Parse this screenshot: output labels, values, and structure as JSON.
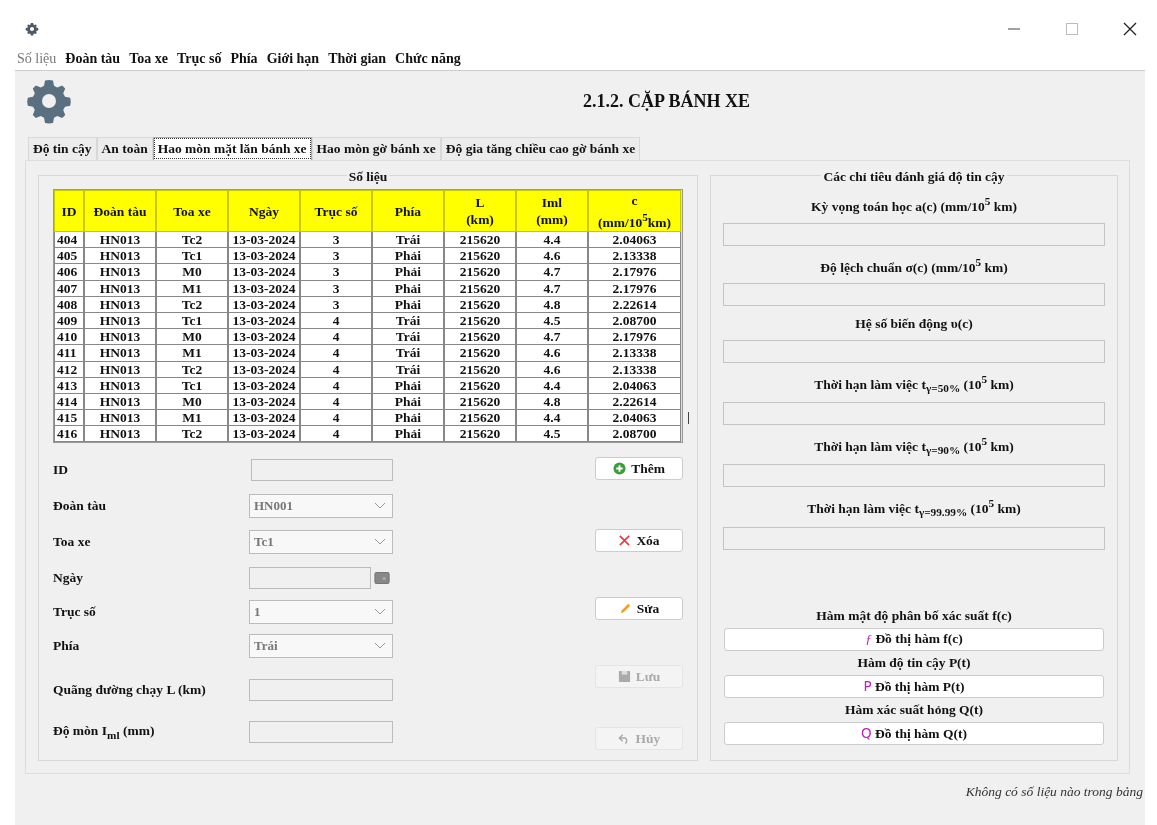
{
  "menu": [
    {
      "label": "Số liệu",
      "disabled": true
    },
    {
      "label": "Đoàn tàu",
      "disabled": false
    },
    {
      "label": "Toa xe",
      "disabled": false
    },
    {
      "label": "Trục số",
      "disabled": false
    },
    {
      "label": "Phía",
      "disabled": false
    },
    {
      "label": "Giới hạn",
      "disabled": false
    },
    {
      "label": "Thời gian",
      "disabled": false
    },
    {
      "label": "Chức năng",
      "disabled": false
    }
  ],
  "heading": "2.1.2. CẶP BÁNH XE",
  "tabs": [
    {
      "label": "Độ tin cậy",
      "selected": false
    },
    {
      "label": "An toàn",
      "selected": false
    },
    {
      "label": "Hao mòn mặt lăn bánh xe",
      "selected": true
    },
    {
      "label": "Hao mòn gờ bánh xe",
      "selected": false
    },
    {
      "label": "Độ gia tăng chiều cao gờ bánh xe",
      "selected": false
    }
  ],
  "data_group": {
    "title": "Số liệu",
    "table": {
      "columns": [
        "ID",
        "Đoàn tàu",
        "Toa xe",
        "Ngày",
        "Trục số",
        "Phía",
        "L\n(km)",
        "Iml\n(mm)",
        "c\n(mm/10$^{5}$km)"
      ],
      "rows": [
        [
          "404",
          "HN013",
          "Tc2",
          "13-03-2024",
          "3",
          "Trái",
          "215620",
          "4.4",
          "2.04063"
        ],
        [
          "405",
          "HN013",
          "Tc1",
          "13-03-2024",
          "3",
          "Phải",
          "215620",
          "4.6",
          "2.13338"
        ],
        [
          "406",
          "HN013",
          "M0",
          "13-03-2024",
          "3",
          "Phải",
          "215620",
          "4.7",
          "2.17976"
        ],
        [
          "407",
          "HN013",
          "M1",
          "13-03-2024",
          "3",
          "Phải",
          "215620",
          "4.7",
          "2.17976"
        ],
        [
          "408",
          "HN013",
          "Tc2",
          "13-03-2024",
          "3",
          "Phải",
          "215620",
          "4.8",
          "2.22614"
        ],
        [
          "409",
          "HN013",
          "Tc1",
          "13-03-2024",
          "4",
          "Trái",
          "215620",
          "4.5",
          "2.08700"
        ],
        [
          "410",
          "HN013",
          "M0",
          "13-03-2024",
          "4",
          "Trái",
          "215620",
          "4.7",
          "2.17976"
        ],
        [
          "411",
          "HN013",
          "M1",
          "13-03-2024",
          "4",
          "Trái",
          "215620",
          "4.6",
          "2.13338"
        ],
        [
          "412",
          "HN013",
          "Tc2",
          "13-03-2024",
          "4",
          "Trái",
          "215620",
          "4.6",
          "2.13338"
        ],
        [
          "413",
          "HN013",
          "Tc1",
          "13-03-2024",
          "4",
          "Phải",
          "215620",
          "4.4",
          "2.04063"
        ],
        [
          "414",
          "HN013",
          "M0",
          "13-03-2024",
          "4",
          "Phải",
          "215620",
          "4.8",
          "2.22614"
        ],
        [
          "415",
          "HN013",
          "M1",
          "13-03-2024",
          "4",
          "Phải",
          "215620",
          "4.4",
          "2.04063"
        ],
        [
          "416",
          "HN013",
          "Tc2",
          "13-03-2024",
          "4",
          "Phải",
          "215620",
          "4.5",
          "2.08700"
        ]
      ]
    },
    "fields": [
      {
        "label": "ID",
        "kind": "input"
      },
      {
        "label": "Đoàn tàu",
        "kind": "select",
        "value": "HN001"
      },
      {
        "label": "Toa xe",
        "kind": "select",
        "value": "Tc1"
      },
      {
        "label": "Ngày",
        "kind": "date"
      },
      {
        "label": "Trục số",
        "kind": "select",
        "value": "1"
      },
      {
        "label": "Phía",
        "kind": "select",
        "value": "Trái"
      },
      {
        "label": "Quãng đường chạy L (km)",
        "kind": "input"
      },
      {
        "label": "Độ mòn I$_{ml}$ (mm)",
        "kind": "input"
      }
    ],
    "buttons": [
      {
        "label": "Thêm",
        "kind": "add",
        "disabled": false
      },
      {
        "label": "Xóa",
        "kind": "delete",
        "disabled": false
      },
      {
        "label": "Sửa",
        "kind": "edit",
        "disabled": false
      },
      {
        "label": "Lưu",
        "kind": "save",
        "disabled": true
      },
      {
        "label": "Hủy",
        "kind": "undo",
        "disabled": true
      }
    ]
  },
  "criteria_group": {
    "title": "Các chỉ tiêu đánh giá độ tin cậy",
    "items": [
      {
        "label": "Kỳ vọng toán học a(c) (mm/10$^{5}$ km)",
        "kind": "field"
      },
      {
        "label": "Độ lệch chuẩn σ(c) (mm/10$^{5}$ km)",
        "kind": "field"
      },
      {
        "label": "Hệ số biến động υ(c)",
        "kind": "field"
      },
      {
        "label": "Thời hạn làm việc t$_{γ=50%}$ (10$^{5}$ km)",
        "kind": "field"
      },
      {
        "label": "Thời hạn làm việc t$_{γ=90%}$ (10$^{5}$ km)",
        "kind": "field"
      },
      {
        "label": "Thời hạn làm việc t$_{γ=99.99%}$ (10$^{5}$ km)",
        "kind": "field"
      },
      {
        "label": "Hàm mật độ phân bố xác suất f(c)",
        "kind": "button",
        "button": "Đồ thị hàm f(c)",
        "icon_char": "ƒ"
      },
      {
        "label": "Hàm độ tin cậy P(t)",
        "kind": "button",
        "button": "Đồ thị hàm P(t)",
        "icon_char": "P"
      },
      {
        "label": "Hàm xác suất hỏng Q(t)",
        "kind": "button",
        "button": "Đồ thị hàm Q(t)",
        "icon_char": "Q"
      }
    ]
  },
  "status_bar": "Không có số liệu nào trong bảng"
}
